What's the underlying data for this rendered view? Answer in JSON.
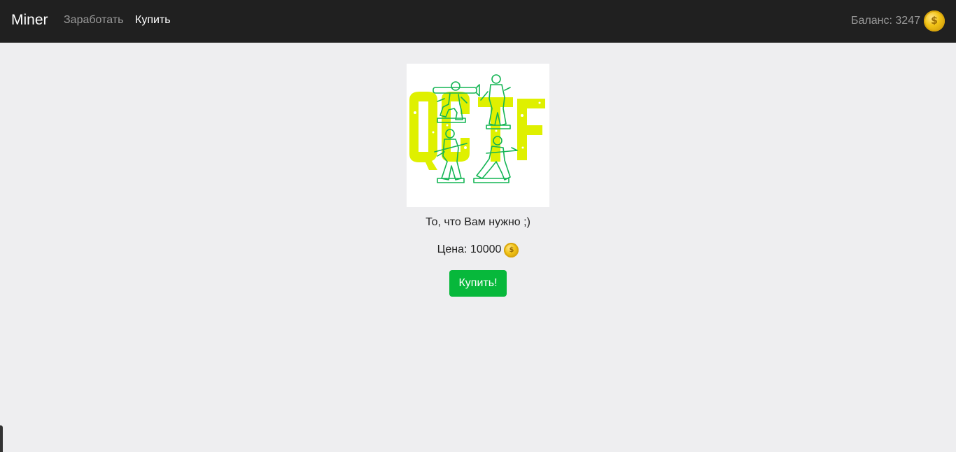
{
  "navbar": {
    "brand": "Miner",
    "links": [
      {
        "label": "Заработать",
        "active": false
      },
      {
        "label": "Купить",
        "active": true
      }
    ],
    "balance_label": "Баланс: 3247",
    "coin_icon": "gold-coin-icon"
  },
  "product": {
    "image_text": "QCTF",
    "image_icon": "toy-soldiers-logo",
    "description": "То, что Вам нужно ;)",
    "price_label": "Цена: 10000",
    "buy_button": "Купить!"
  },
  "colors": {
    "navbar_bg": "#202020",
    "page_bg": "#eeeef0",
    "buy_button": "#07b83b",
    "logo_yellow": "#dff000",
    "logo_green": "#14b554"
  }
}
